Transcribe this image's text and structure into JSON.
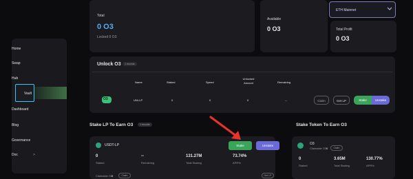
{
  "sidebar": {
    "items": [
      {
        "label": "Home"
      },
      {
        "label": "Swap"
      },
      {
        "label": "Hub"
      },
      {
        "label": "Vault"
      },
      {
        "label": "Dashboard"
      },
      {
        "label": "Blog"
      },
      {
        "label": "Governance"
      },
      {
        "label": "Doc"
      }
    ],
    "doc_chevron": ">"
  },
  "total": {
    "label": "Total",
    "value": "0 O3",
    "locked": "Locked 0 O3"
  },
  "available": {
    "label": "Available",
    "value": "0 O3"
  },
  "network": {
    "selected": "ETH Mainnet"
  },
  "total_profit": {
    "label": "Total Profit",
    "value": "0 O3"
  },
  "unlock": {
    "title": "Unlock O3",
    "badge": "1 records",
    "columns": [
      "Name",
      "Staked",
      "Speed",
      "Unlocked Amount",
      "Remaining"
    ],
    "row": {
      "name": "UNI-LP",
      "staked": "0",
      "speed": "0",
      "unlocked": "0",
      "remaining": "--"
    },
    "claim_label": "Claim",
    "get_lp_label": "Get LP",
    "stake_label": "Stake",
    "unstake_label": "Unstake"
  },
  "stake_lp": {
    "title": "Stake LP To Earn O3",
    "badge": "1 records",
    "pool_name": "USDT-LP",
    "stake_label": "Stake",
    "unstake_label": "Unstake",
    "stats": [
      {
        "value": "0",
        "label": "Staked"
      },
      {
        "value": "--",
        "label": "Remaining"
      },
      {
        "value": "131.27M",
        "label": "Total Staking"
      },
      {
        "value": "73.74%",
        "label": "APR%"
      }
    ],
    "claimable_label": "Claimable O3:",
    "claimable_value": "0",
    "claim_label": "Claim",
    "get_lp_label": "Get LP"
  },
  "stake_token": {
    "title": "Stake Token To Earn O3",
    "token_name": "O3",
    "claimable_label": "Claimable O3:",
    "claimable_value": "0",
    "claim_label": "Claim",
    "stats": [
      {
        "value": "0",
        "label": "Staked"
      },
      {
        "value": "3.65M",
        "label": "Total Staking"
      },
      {
        "value": "130.77%",
        "label": "APR%"
      }
    ]
  },
  "colors": {
    "accent_blue": "#36c8ff",
    "stake_green": "#3aa55a",
    "unstake_purple": "#6a6ad8",
    "arrow_red": "#e8332a"
  }
}
